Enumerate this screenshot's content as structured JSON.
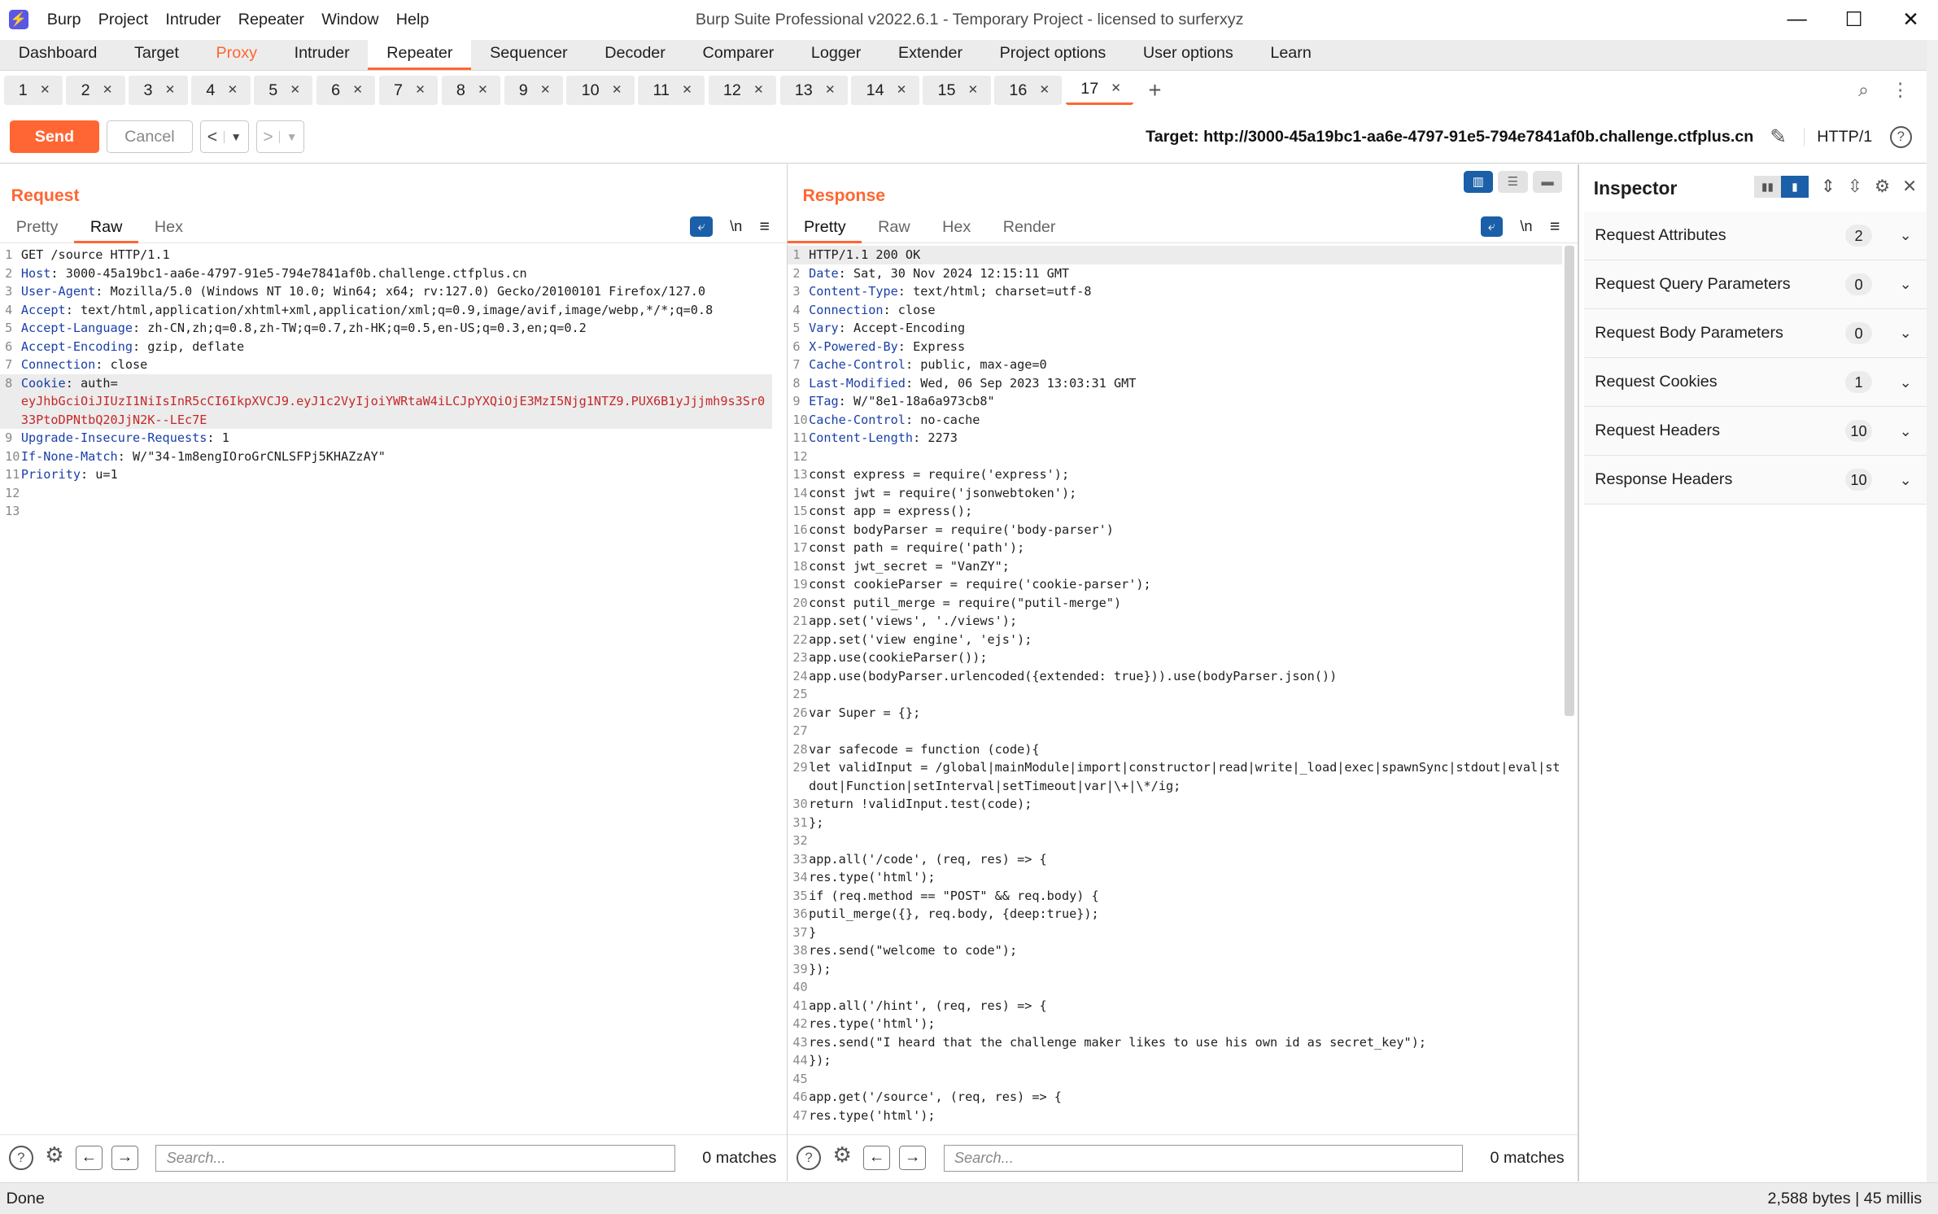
{
  "app": {
    "title": "Burp Suite Professional v2022.6.1 - Temporary Project - licensed to surferxyz",
    "icon": "burp-lightning-icon"
  },
  "menu": [
    "Burp",
    "Project",
    "Intruder",
    "Repeater",
    "Window",
    "Help"
  ],
  "tool_tabs": [
    "Dashboard",
    "Target",
    "Proxy",
    "Intruder",
    "Repeater",
    "Sequencer",
    "Decoder",
    "Comparer",
    "Logger",
    "Extender",
    "Project options",
    "User options",
    "Learn"
  ],
  "active_tool_tab": "Repeater",
  "highlight_tab": "Proxy",
  "repeater_tabs": [
    "1",
    "2",
    "3",
    "4",
    "5",
    "6",
    "7",
    "8",
    "9",
    "10",
    "11",
    "12",
    "13",
    "14",
    "15",
    "16",
    "17"
  ],
  "active_repeater_tab": "17",
  "toolbar": {
    "send_label": "Send",
    "cancel_label": "Cancel",
    "target": "Target: http://3000-45a19bc1-aa6e-4797-91e5-794e7841af0b.challenge.ctfplus.cn",
    "protocol": "HTTP/1"
  },
  "colors": {
    "accent": "#ff6633",
    "header_key": "#1a3fa8",
    "cookie_value": "#c62828"
  },
  "request": {
    "title": "Request",
    "tabs": [
      "Pretty",
      "Raw",
      "Hex"
    ],
    "active_tab": "Raw",
    "lines": [
      {
        "n": "1",
        "text": "GET /source HTTP/1.1"
      },
      {
        "n": "2",
        "key": "Host",
        "text": "3000-45a19bc1-aa6e-4797-91e5-794e7841af0b.challenge.ctfplus.cn"
      },
      {
        "n": "3",
        "key": "User-Agent",
        "text": "Mozilla/5.0 (Windows NT 10.0; Win64; x64; rv:127.0) Gecko/20100101 Firefox/127.0"
      },
      {
        "n": "4",
        "key": "Accept",
        "text": "text/html,application/xhtml+xml,application/xml;q=0.9,image/avif,image/webp,*/*;q=0.8"
      },
      {
        "n": "5",
        "key": "Accept-Language",
        "text": "zh-CN,zh;q=0.8,zh-TW;q=0.7,zh-HK;q=0.5,en-US;q=0.3,en;q=0.2"
      },
      {
        "n": "6",
        "key": "Accept-Encoding",
        "text": "gzip, deflate"
      },
      {
        "n": "7",
        "key": "Connection",
        "text": "close"
      },
      {
        "n": "8",
        "key": "Cookie",
        "text": "auth=",
        "extra": "eyJhbGciOiJIUzI1NiIsInR5cCI6IkpXVCJ9.eyJ1c2VyIjoiYWRtaW4iLCJpYXQiOjE3MzI5Njg1NTZ9.PUX6B1yJjjmh9s3Sr033PtoDPNtbQ20JjN2K--LEc7E",
        "highlight": true
      },
      {
        "n": "9",
        "key": "Upgrade-Insecure-Requests",
        "text": "1"
      },
      {
        "n": "10",
        "key": "If-None-Match",
        "text": "W/\"34-1m8engIOroGrCNLSFPj5KHAZzAY\""
      },
      {
        "n": "11",
        "key": "Priority",
        "text": "u=1"
      },
      {
        "n": "12",
        "text": ""
      },
      {
        "n": "13",
        "text": ""
      }
    ],
    "search_placeholder": "Search...",
    "matches": "0 matches"
  },
  "response": {
    "title": "Response",
    "tabs": [
      "Pretty",
      "Raw",
      "Hex",
      "Render"
    ],
    "active_tab": "Pretty",
    "lines": [
      {
        "n": "1",
        "text": "HTTP/1.1 200 OK",
        "highlight": true
      },
      {
        "n": "2",
        "key": "Date",
        "text": "Sat, 30 Nov 2024 12:15:11 GMT"
      },
      {
        "n": "3",
        "key": "Content-Type",
        "text": "text/html; charset=utf-8"
      },
      {
        "n": "4",
        "key": "Connection",
        "text": "close"
      },
      {
        "n": "5",
        "key": "Vary",
        "text": "Accept-Encoding"
      },
      {
        "n": "6",
        "key": "X-Powered-By",
        "text": "Express"
      },
      {
        "n": "7",
        "key": "Cache-Control",
        "text": "public, max-age=0"
      },
      {
        "n": "8",
        "key": "Last-Modified",
        "text": "Wed, 06 Sep 2023 13:03:31 GMT"
      },
      {
        "n": "9",
        "key": "ETag",
        "text": "W/\"8e1-18a6a973cb8\""
      },
      {
        "n": "10",
        "key": "Cache-Control",
        "text": "no-cache"
      },
      {
        "n": "11",
        "key": "Content-Length",
        "text": "2273"
      },
      {
        "n": "12",
        "text": ""
      },
      {
        "n": "13",
        "text": "const express = require('express');"
      },
      {
        "n": "14",
        "text": "const jwt = require('jsonwebtoken');"
      },
      {
        "n": "15",
        "text": "const app = express();"
      },
      {
        "n": "16",
        "text": "const bodyParser = require('body-parser')"
      },
      {
        "n": "17",
        "text": "const path = require('path');"
      },
      {
        "n": "18",
        "text": "const jwt_secret = \"VanZY\";"
      },
      {
        "n": "19",
        "text": "const cookieParser = require('cookie-parser');"
      },
      {
        "n": "20",
        "text": "const putil_merge = require(\"putil-merge\")"
      },
      {
        "n": "21",
        "text": "app.set('views', './views');"
      },
      {
        "n": "22",
        "text": "app.set('view engine', 'ejs');"
      },
      {
        "n": "23",
        "text": "app.use(cookieParser());"
      },
      {
        "n": "24",
        "text": "app.use(bodyParser.urlencoded({extended: true})).use(bodyParser.json())"
      },
      {
        "n": "25",
        "text": ""
      },
      {
        "n": "26",
        "text": "var Super = {};"
      },
      {
        "n": "27",
        "text": ""
      },
      {
        "n": "28",
        "text": "var safecode = function (code){"
      },
      {
        "n": "29",
        "text": "let validInput = /global|mainModule|import|constructor|read|write|_load|exec|spawnSync|stdout|eval|stdout|Function|setInterval|setTimeout|var|\\+|\\*/ig;"
      },
      {
        "n": "30",
        "text": "return !validInput.test(code);"
      },
      {
        "n": "31",
        "text": "};"
      },
      {
        "n": "32",
        "text": ""
      },
      {
        "n": "33",
        "text": "app.all('/code', (req, res) => {"
      },
      {
        "n": "34",
        "text": "res.type('html');"
      },
      {
        "n": "35",
        "text": "if (req.method == \"POST\" && req.body) {"
      },
      {
        "n": "36",
        "text": "putil_merge({}, req.body, {deep:true});"
      },
      {
        "n": "37",
        "text": "}"
      },
      {
        "n": "38",
        "text": "res.send(\"welcome to code\");"
      },
      {
        "n": "39",
        "text": "});"
      },
      {
        "n": "40",
        "text": ""
      },
      {
        "n": "41",
        "text": "app.all('/hint', (req, res) => {"
      },
      {
        "n": "42",
        "text": "res.type('html');"
      },
      {
        "n": "43",
        "text": "res.send(\"I heard that the challenge maker likes to use his own id as secret_key\");"
      },
      {
        "n": "44",
        "text": "});"
      },
      {
        "n": "45",
        "text": ""
      },
      {
        "n": "46",
        "text": "app.get('/source', (req, res) => {"
      },
      {
        "n": "47",
        "text": "res.type('html');"
      }
    ],
    "search_placeholder": "Search...",
    "matches": "0 matches"
  },
  "inspector": {
    "title": "Inspector",
    "sections": [
      {
        "label": "Request Attributes",
        "count": "2"
      },
      {
        "label": "Request Query Parameters",
        "count": "0"
      },
      {
        "label": "Request Body Parameters",
        "count": "0"
      },
      {
        "label": "Request Cookies",
        "count": "1"
      },
      {
        "label": "Request Headers",
        "count": "10"
      },
      {
        "label": "Response Headers",
        "count": "10"
      }
    ]
  },
  "status": {
    "left": "Done",
    "right": "2,588 bytes | 45 millis"
  }
}
